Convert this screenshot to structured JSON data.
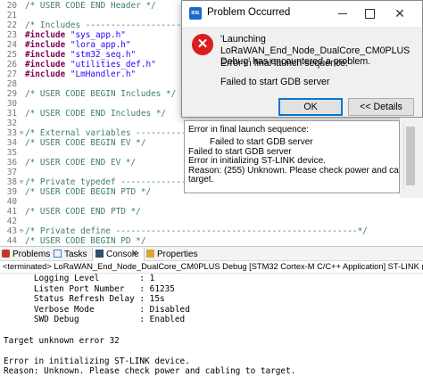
{
  "editor": {
    "lines": [
      {
        "num": "20",
        "fold": "",
        "text": "/* USER CODE END Header */",
        "style": "comment"
      },
      {
        "num": "21",
        "fold": "",
        "text": "",
        "style": "plain"
      },
      {
        "num": "22",
        "fold": "",
        "text": "/* Includes --------------------------------------------------*/",
        "style": "comment"
      },
      {
        "num": "23",
        "fold": "",
        "text": "#include \"sys_app.h\"",
        "style": "include"
      },
      {
        "num": "24",
        "fold": "",
        "text": "#include \"lora_app.h\"",
        "style": "include"
      },
      {
        "num": "25",
        "fold": "",
        "text": "#include \"stm32_seq.h\"",
        "style": "include"
      },
      {
        "num": "26",
        "fold": "",
        "text": "#include \"utilities_def.h\"",
        "style": "include"
      },
      {
        "num": "27",
        "fold": "",
        "text": "#include \"LmHandler.h\"",
        "style": "include"
      },
      {
        "num": "28",
        "fold": "",
        "text": "",
        "style": "plain"
      },
      {
        "num": "29",
        "fold": "",
        "text": "/* USER CODE BEGIN Includes */",
        "style": "comment"
      },
      {
        "num": "30",
        "fold": "",
        "text": "",
        "style": "plain"
      },
      {
        "num": "31",
        "fold": "",
        "text": "/* USER CODE END Includes */",
        "style": "comment"
      },
      {
        "num": "32",
        "fold": "",
        "text": "",
        "style": "plain"
      },
      {
        "num": "33",
        "fold": "⊖",
        "text": "/* External variables -------------------------------------------*/",
        "style": "comment"
      },
      {
        "num": "34",
        "fold": "",
        "text": "/* USER CODE BEGIN EV */",
        "style": "comment"
      },
      {
        "num": "35",
        "fold": "",
        "text": "",
        "style": "plain"
      },
      {
        "num": "36",
        "fold": "",
        "text": "/* USER CODE END EV */",
        "style": "comment"
      },
      {
        "num": "37",
        "fold": "",
        "text": "",
        "style": "plain"
      },
      {
        "num": "38",
        "fold": "⊖",
        "text": "/* Private typedef -----------------------------------------------*/",
        "style": "comment"
      },
      {
        "num": "39",
        "fold": "",
        "text": "/* USER CODE BEGIN PTD */",
        "style": "comment"
      },
      {
        "num": "40",
        "fold": "",
        "text": "",
        "style": "plain"
      },
      {
        "num": "41",
        "fold": "",
        "text": "/* USER CODE END PTD */",
        "style": "comment"
      },
      {
        "num": "42",
        "fold": "",
        "text": "",
        "style": "plain"
      },
      {
        "num": "43",
        "fold": "⊖",
        "text": "/* Private define ------------------------------------------------*/",
        "style": "comment"
      },
      {
        "num": "44",
        "fold": "",
        "text": "/* USER CODE BEGIN PD */",
        "style": "comment"
      }
    ]
  },
  "dialog": {
    "title": "Problem Occurred",
    "app_icon_text": "IDE",
    "message": "'Launching LoRaWAN_End_Node_DualCore_CM0PLUS Debug' has encountered a problem.",
    "message_line1": "Error in final launch sequence:",
    "message_line2": "Failed to start GDB server",
    "ok_label": "OK",
    "details_label": "<< Details",
    "close_glyph": "✕",
    "details": {
      "line1": "Error in final launch sequence:",
      "line2": "Failed to start GDB server",
      "line3": "Failed to start GDB server",
      "line4": "Error in initializing ST-LINK device.",
      "line5": "Reason: (255) Unknown. Please check power and cabling to",
      "line6": "target."
    }
  },
  "panel": {
    "tabs": {
      "problems": "Problems",
      "tasks": "Tasks",
      "console": "Console",
      "properties": "Properties"
    },
    "status": "<terminated> LoRaWAN_End_Node_DualCore_CM0PLUS Debug [STM32 Cortex-M C/C++ Application] ST-LINK (ST-LINK GDB server)",
    "console_lines": [
      "      Logging Level        : 1",
      "      Listen Port Number   : 61235",
      "      Status Refresh Delay : 15s",
      "      Verbose Mode         : Disabled",
      "      SWD Debug            : Enabled",
      "",
      "Target unknown error 32",
      "",
      "Error in initializing ST-LINK device.",
      "Reason: Unknown. Please check power and cabling to target."
    ]
  },
  "colors": {
    "comment": "#3f7f5f",
    "keyword": "#7f0055",
    "string": "#2a00ff",
    "error_icon": "#d81e1e",
    "default_button_border": "#0078d7"
  }
}
